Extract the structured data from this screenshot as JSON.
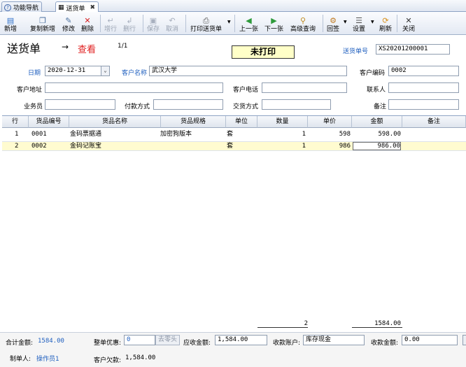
{
  "tabs": [
    {
      "label": "功能导航",
      "icon": "help-icon"
    },
    {
      "label": "送货单",
      "icon": "grid-icon",
      "close": "✖"
    }
  ],
  "toolbar": {
    "new": "新增",
    "copy_new": "复制新增",
    "edit": "修改",
    "delete": "删除",
    "add_row": "增行",
    "delete_row": "删行",
    "save": "保存",
    "cancel": "取消",
    "print": "打印送货单",
    "prev": "上一张",
    "next": "下一张",
    "advanced_search": "高级查询",
    "review": "回签",
    "settings": "设置",
    "refresh": "刷新",
    "close": "关闭"
  },
  "header": {
    "title": "送货单",
    "view_mode": "查看",
    "pager": "1/1",
    "print_status": "未打印",
    "doc_no_label": "送货单号",
    "doc_no": "XS20201200001"
  },
  "form": {
    "date_label": "日期",
    "date": "2020-12-31",
    "customer_name_label": "客户名称",
    "customer_name": "武汉大学",
    "customer_code_label": "客户编码",
    "customer_code": "0002",
    "address_label": "客户地址",
    "address": "",
    "phone_label": "客户电话",
    "phone": "",
    "contact_label": "联系人",
    "contact": "",
    "salesman_label": "业务员",
    "salesman": "",
    "payment_label": "付款方式",
    "payment": "",
    "delivery_label": "交货方式",
    "delivery": "",
    "remark_label": "备注",
    "remark": ""
  },
  "table": {
    "columns": [
      "行",
      "货品编号",
      "货品名称",
      "货品规格",
      "单位",
      "数量",
      "单价",
      "金额",
      "备注"
    ],
    "rows": [
      {
        "line": "1",
        "code": "0001",
        "name": "金码票据通",
        "spec": "加密狗版本",
        "unit": "套",
        "qty": "1",
        "price": "598",
        "amount": "598.00",
        "remark": ""
      },
      {
        "line": "2",
        "code": "0002",
        "name": "金码记账宝",
        "spec": "",
        "unit": "套",
        "qty": "1",
        "price": "986",
        "amount": "986.00",
        "remark": ""
      }
    ],
    "total_qty": "2",
    "total_amount": "1584.00"
  },
  "footer": {
    "total_label": "合计金额:",
    "total": "1584.00",
    "discount_label": "整单优惠:",
    "discount": "0",
    "round_button": "去零头",
    "receivable_label": "应收金额:",
    "receivable": "1,584.00",
    "account_label": "收款账户:",
    "account": "库存现金",
    "received_label": "收款金额:",
    "received": "0.00",
    "maker_label": "制单人:",
    "maker": "操作员1",
    "debt_label": "客户欠款:",
    "debt": "1,584.00"
  },
  "colors": {
    "accent_blue": "#1f5fbf",
    "status_bg": "#ffffc8",
    "selected_row": "#fffbd0",
    "view_red": "#e02020"
  }
}
